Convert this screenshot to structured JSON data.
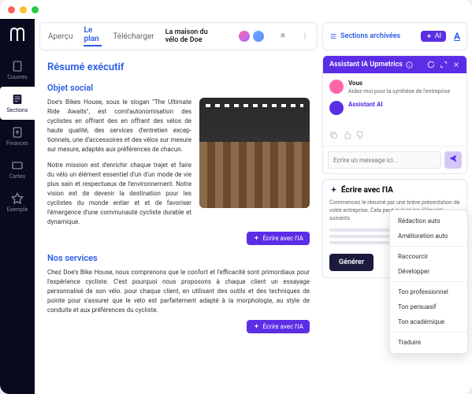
{
  "sidebar": {
    "items": [
      {
        "label": "Couvres"
      },
      {
        "label": "Sections"
      },
      {
        "label": "Finances"
      },
      {
        "label": "Cartes"
      },
      {
        "label": "Exemple"
      }
    ]
  },
  "topbar": {
    "tabs": [
      {
        "label": "Aperçu"
      },
      {
        "label": "Le plan"
      },
      {
        "label": "Télécharger"
      }
    ],
    "doc_title": "La maison du vélo de Doe"
  },
  "doc": {
    "h1": "Résumé exécutif",
    "section1_title": "Objet social",
    "section1_p1": "Doe's Bikes House, sous le slogan \"The Ultimate Ride Awaits\", est com­l'autonomisation des cyclistes en of­frant des en offrant des vélos de haute qualité, des services d'entretien excep­tionnels, une d'accessoires et des vélos sur mesure sur mesure, adaptés aux préférences de chacun.",
    "section1_p2": "Notre mission est d'enrichir chaque trajet et faire du vélo un élément essentiel d'un d'un mode de vie plus sain et respectueux de l'environnement. Notre vision est de devenir la destination pour les cyclistes du monde entier et et de favoriser l'émergence d'une commu­nauté cycliste durable et dynamique.",
    "section2_title": "Nos services",
    "section2_p1": "Chez Doe's Bike House, nous comprenons que le confort et l'efficacité sont primordi­aux pour l'expérience cycliste. C'est pourquoi nous proposons à chaque client un essa­yage personnalisé de son vélo. pour chaque client, en utilisant des outils et des tech­niques de pointe pour s'assurer que le vélo est parfaitement adapté à la morphologie, au style de conduite et aux préférences du cycliste.",
    "ai_btn": "Écrire avec l'IA"
  },
  "right": {
    "archived": "Sections archivées",
    "ai_badge": "AI",
    "underline": "A"
  },
  "chat": {
    "title": "Assistant IA Upmetrics",
    "user_name": "Vous",
    "user_msg": "Aidez-moi pour la synthèse de l'entreprise",
    "bot_name": "Assistant AI",
    "placeholder": "Écrire un message ici..."
  },
  "write": {
    "title": "Écrire avec l'IA",
    "desc": "Commencez le résumé par une brève présentation de votre entreprise. Cela peut inclure les éléments suivants",
    "generate": "Générer"
  },
  "dropdown": {
    "items": [
      "Rédaction auto",
      "Amélioration auto",
      "Raccourcir",
      "Développer",
      "Ton professionnel",
      "Ton persuasif",
      "Ton académique",
      "Traduire"
    ]
  }
}
